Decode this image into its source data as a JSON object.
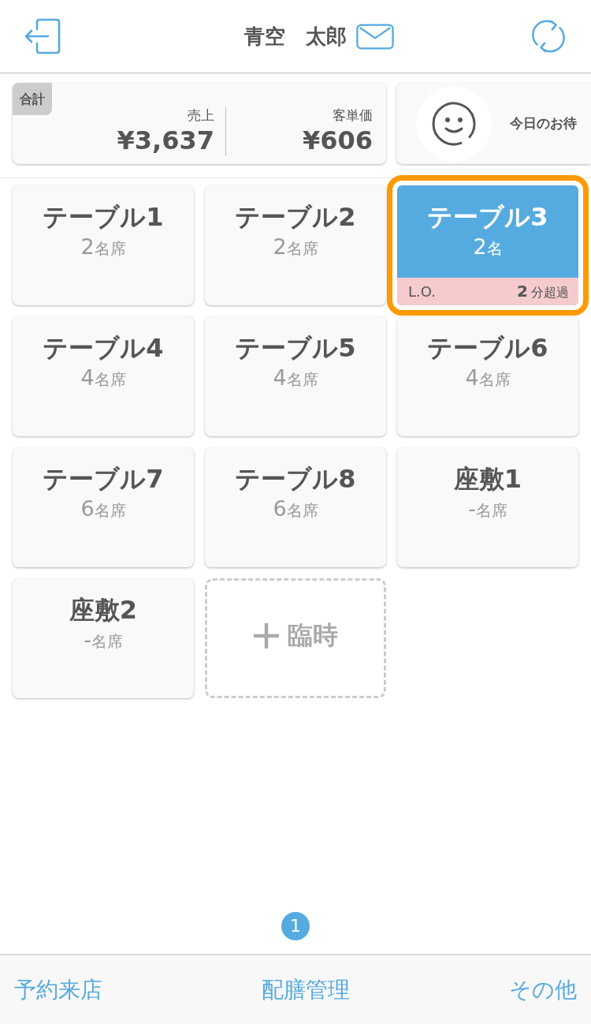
{
  "header": {
    "title": "青空　太郎"
  },
  "summary": {
    "badge": "合計",
    "metrics": [
      {
        "label": "売上",
        "value": "¥3,637"
      },
      {
        "label": "客単価",
        "value": "¥606"
      }
    ],
    "waiting": {
      "text": "今日のお待"
    }
  },
  "tables": [
    {
      "kind": "table",
      "name": "テーブル1",
      "count": "2",
      "unit": "名席",
      "occupied": false,
      "selected": false
    },
    {
      "kind": "table",
      "name": "テーブル2",
      "count": "2",
      "unit": "名席",
      "occupied": false,
      "selected": false
    },
    {
      "kind": "table",
      "name": "テーブル3",
      "count": "2",
      "unit": "名",
      "occupied": true,
      "selected": true,
      "alert": {
        "label": "L.O.",
        "value": "2",
        "unit": "分超過"
      }
    },
    {
      "kind": "table",
      "name": "テーブル4",
      "count": "4",
      "unit": "名席",
      "occupied": false,
      "selected": false
    },
    {
      "kind": "table",
      "name": "テーブル5",
      "count": "4",
      "unit": "名席",
      "occupied": false,
      "selected": false
    },
    {
      "kind": "table",
      "name": "テーブル6",
      "count": "4",
      "unit": "名席",
      "occupied": false,
      "selected": false
    },
    {
      "kind": "table",
      "name": "テーブル7",
      "count": "6",
      "unit": "名席",
      "occupied": false,
      "selected": false
    },
    {
      "kind": "table",
      "name": "テーブル8",
      "count": "6",
      "unit": "名席",
      "occupied": false,
      "selected": false
    },
    {
      "kind": "table",
      "name": "座敷1",
      "count": "-",
      "unit": "名席",
      "occupied": false,
      "selected": false
    },
    {
      "kind": "table",
      "name": "座敷2",
      "count": "-",
      "unit": "名席",
      "occupied": false,
      "selected": false
    },
    {
      "kind": "add",
      "label": "臨時"
    }
  ],
  "pager": {
    "current": "1"
  },
  "footer": {
    "items": [
      {
        "label": "予約来店"
      },
      {
        "label": "配膳管理"
      },
      {
        "label": "その他"
      }
    ]
  }
}
